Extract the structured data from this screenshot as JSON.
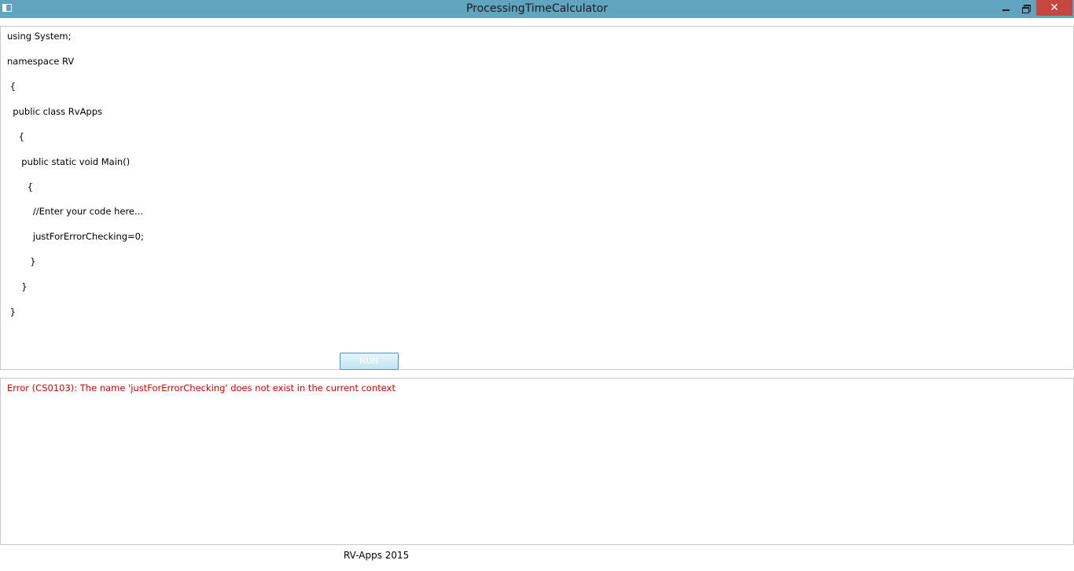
{
  "window": {
    "title": "ProcessingTimeCalculator",
    "close_glyph": "✕"
  },
  "editor": {
    "lines": [
      "using System;",
      "namespace RV",
      " {",
      "  public class RvApps",
      "    {",
      "     public static void Main()",
      "       {",
      "         //Enter your code here...",
      "         justForErrorChecking=0;",
      "        }",
      "     }",
      " }"
    ]
  },
  "run_button": {
    "label": "RUN"
  },
  "output": {
    "error": "Error (CS0103): The name 'justForErrorChecking' does not exist in the current context"
  },
  "footer": {
    "text": "RV-Apps 2015"
  },
  "colors": {
    "titlebar": "#62a3bf",
    "close_button": "#c7463f",
    "error_text": "#d40000"
  }
}
